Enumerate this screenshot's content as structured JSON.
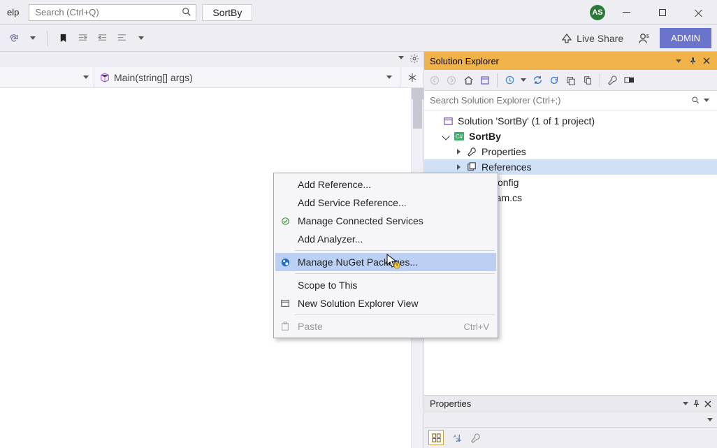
{
  "titlebar": {
    "help_label": "elp",
    "search_placeholder": "Search (Ctrl+Q)",
    "project_name": "SortBy",
    "avatar_initials": "AS"
  },
  "cmdrow": {
    "live_share_label": "Live Share",
    "admin_label": "ADMIN"
  },
  "nav": {
    "method_signature": "Main(string[] args)"
  },
  "solution_explorer": {
    "title": "Solution Explorer",
    "search_placeholder": "Search Solution Explorer (Ctrl+;)",
    "solution_label": "Solution 'SortBy' (1 of 1 project)",
    "project_label": "SortBy",
    "items": {
      "properties": "Properties",
      "references": "References",
      "config_fragment": "config",
      "program_fragment": "ram.cs"
    }
  },
  "context_menu": {
    "add_reference": "Add Reference...",
    "add_service_reference": "Add Service Reference...",
    "manage_connected": "Manage Connected Services",
    "add_analyzer": "Add Analyzer...",
    "manage_nuget": "Manage NuGet Packages...",
    "scope_to_this": "Scope to This",
    "new_view": "New Solution Explorer View",
    "paste": "Paste",
    "paste_shortcut": "Ctrl+V"
  },
  "properties_panel": {
    "title": "Properties"
  }
}
